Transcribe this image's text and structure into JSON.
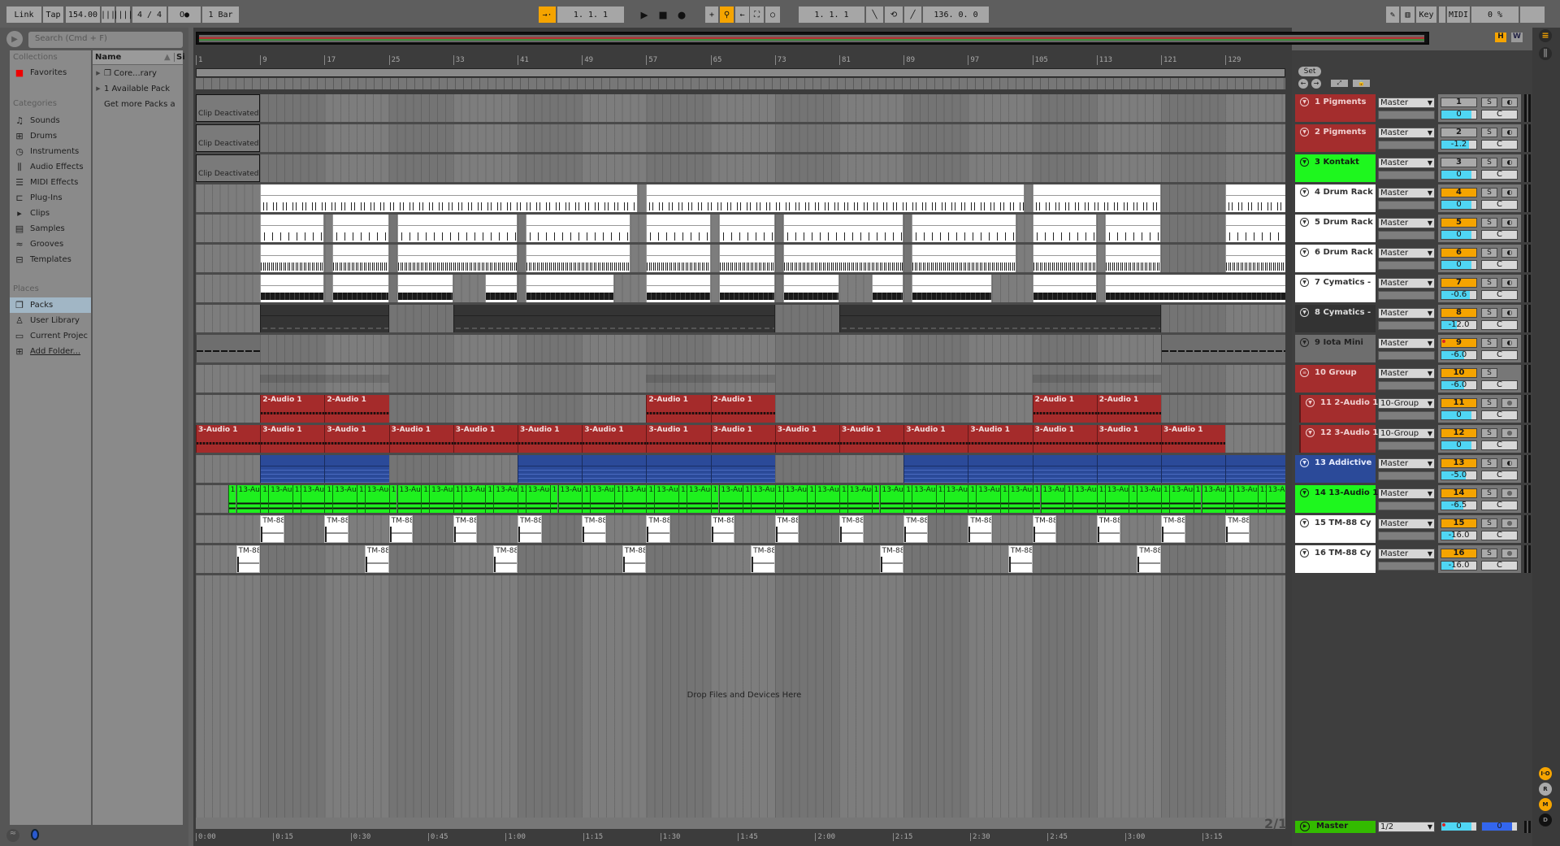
{
  "topbar": {
    "link": "Link",
    "tap": "Tap",
    "tempo": "154.00",
    "signature": "4 / 4",
    "metronome": "O●",
    "quantize": "1 Bar",
    "position": "1.  1.  1",
    "loop_start": "1.  1.  1",
    "loop_length": "136.  0.  0",
    "key": "Key",
    "midi": "MIDI",
    "cpu": "0 %"
  },
  "browser": {
    "search_placeholder": "Search (Cmd + F)",
    "collections_header": "Collections",
    "favorites": "Favorites",
    "categories_header": "Categories",
    "categories": [
      {
        "label": "Sounds",
        "icon": "♫"
      },
      {
        "label": "Drums",
        "icon": "⊞"
      },
      {
        "label": "Instruments",
        "icon": "◷"
      },
      {
        "label": "Audio Effects",
        "icon": "⫼"
      },
      {
        "label": "MIDI Effects",
        "icon": "☰"
      },
      {
        "label": "Plug-Ins",
        "icon": "⊏"
      },
      {
        "label": "Clips",
        "icon": "▸"
      },
      {
        "label": "Samples",
        "icon": "▤"
      },
      {
        "label": "Grooves",
        "icon": "≈"
      },
      {
        "label": "Templates",
        "icon": "⊟"
      }
    ],
    "places_header": "Places",
    "places": [
      {
        "label": "Packs",
        "icon": "❐",
        "selected": true
      },
      {
        "label": "User Library",
        "icon": "♙"
      },
      {
        "label": "Current Projec",
        "icon": "▭"
      },
      {
        "label": "Add Folder...",
        "icon": "⊞"
      }
    ],
    "name_header": "Name",
    "size_header": "Si",
    "items": [
      {
        "label": "Core...rary",
        "expand": "▶",
        "icon": "❐"
      },
      {
        "label": "1 Available Pack",
        "expand": "▶"
      },
      {
        "label": "Get more Packs a"
      }
    ]
  },
  "arrangement": {
    "overview_buttons": [
      "H",
      "W"
    ],
    "bar_labels": [
      "1",
      "9",
      "17",
      "25",
      "33",
      "41",
      "49",
      "57",
      "65",
      "73",
      "81",
      "89",
      "97",
      "105",
      "113",
      "121",
      "129"
    ],
    "time_labels": [
      "0:00",
      "0:15",
      "0:30",
      "0:45",
      "1:00",
      "1:15",
      "1:30",
      "1:45",
      "2:00",
      "2:15",
      "2:30",
      "2:45",
      "3:00",
      "3:15"
    ],
    "drop_text": "Drop Files and Devices Here",
    "time_sig_display": "2/1"
  },
  "set_label": "Set",
  "tracks": [
    {
      "name": "1 Pigments",
      "color": "#a42d2d",
      "text": "#f1d0d0",
      "output": "Master",
      "num": "1",
      "active": false,
      "vol": "0",
      "vol_frac": 0.85,
      "pan": "C",
      "arm": "◐",
      "kind": "deact",
      "clips": [
        [
          1,
          9,
          "Clip Deactivated"
        ]
      ]
    },
    {
      "name": "2 Pigments",
      "color": "#a42d2d",
      "text": "#f1d0d0",
      "output": "Master",
      "num": "2",
      "active": false,
      "vol": "-1.2",
      "vol_frac": 0.8,
      "pan": "C",
      "arm": "◐",
      "kind": "deact",
      "clips": [
        [
          1,
          9,
          "Clip Deactivated"
        ]
      ]
    },
    {
      "name": "3 Kontakt",
      "color": "#1ef71e",
      "text": "#102010",
      "output": "Master",
      "num": "3",
      "active": false,
      "vol": "0",
      "vol_frac": 0.85,
      "pan": "C",
      "arm": "◐",
      "kind": "deact",
      "clips": [
        [
          1,
          9,
          "Clip Deactivated"
        ]
      ]
    },
    {
      "name": "4 Drum Rack",
      "color": "#ffffff",
      "text": "#333",
      "output": "Master",
      "num": "4",
      "active": true,
      "vol": "0",
      "vol_frac": 0.85,
      "pan": "C",
      "arm": "◐",
      "kind": "midi",
      "clips": [
        [
          9,
          56,
          ""
        ],
        [
          57,
          104,
          ""
        ],
        [
          105,
          121,
          ""
        ],
        [
          129,
          137,
          ""
        ]
      ]
    },
    {
      "name": "5 Drum Rack",
      "color": "#ffffff",
      "text": "#333",
      "output": "Master",
      "num": "5",
      "active": true,
      "vol": "0",
      "vol_frac": 0.85,
      "pan": "C",
      "arm": "◐",
      "kind": "midi midi2",
      "clips": [
        [
          9,
          17,
          ""
        ],
        [
          18,
          25,
          ""
        ],
        [
          26,
          41,
          ""
        ],
        [
          42,
          55,
          ""
        ],
        [
          57,
          65,
          ""
        ],
        [
          66,
          73,
          ""
        ],
        [
          74,
          89,
          ""
        ],
        [
          90,
          103,
          ""
        ],
        [
          105,
          113,
          ""
        ],
        [
          114,
          121,
          ""
        ],
        [
          129,
          137,
          ""
        ]
      ]
    },
    {
      "name": "6 Drum Rack",
      "color": "#ffffff",
      "text": "#333",
      "output": "Master",
      "num": "6",
      "active": true,
      "vol": "0",
      "vol_frac": 0.85,
      "pan": "C",
      "arm": "◐",
      "kind": "midi midi3",
      "clips": [
        [
          9,
          17,
          ""
        ],
        [
          18,
          25,
          ""
        ],
        [
          26,
          41,
          ""
        ],
        [
          42,
          55,
          ""
        ],
        [
          57,
          65,
          ""
        ],
        [
          66,
          73,
          ""
        ],
        [
          74,
          89,
          ""
        ],
        [
          90,
          103,
          ""
        ],
        [
          105,
          113,
          ""
        ],
        [
          114,
          121,
          ""
        ],
        [
          129,
          137,
          ""
        ]
      ]
    },
    {
      "name": "7 Cymatics -",
      "color": "#ffffff",
      "text": "#333",
      "output": "Master",
      "num": "7",
      "active": true,
      "vol": "-0.6",
      "vol_frac": 0.82,
      "pan": "C",
      "arm": "◐",
      "kind": "midi midi4",
      "clips": [
        [
          9,
          17,
          ""
        ],
        [
          18,
          25,
          ""
        ],
        [
          26,
          33,
          ""
        ],
        [
          37,
          41,
          ""
        ],
        [
          42,
          53,
          ""
        ],
        [
          57,
          65,
          ""
        ],
        [
          66,
          73,
          ""
        ],
        [
          74,
          81,
          ""
        ],
        [
          85,
          89,
          ""
        ],
        [
          90,
          100,
          ""
        ],
        [
          105,
          113,
          ""
        ],
        [
          114,
          137,
          ""
        ]
      ]
    },
    {
      "name": "8 Cymatics -",
      "color": "#333333",
      "text": "#dddddd",
      "output": "Master",
      "num": "8",
      "active": true,
      "vol": "-12.0",
      "vol_frac": 0.45,
      "pan": "C",
      "arm": "◐",
      "kind": "dark",
      "clips": [
        [
          9,
          25,
          ""
        ],
        [
          33,
          73,
          ""
        ],
        [
          81,
          121,
          ""
        ]
      ]
    },
    {
      "name": "9 Iota Mini",
      "color": "#6e6e6e",
      "text": "#222",
      "output": "Master",
      "num": "9",
      "active": true,
      "rec_dot": true,
      "vol": "-6.0",
      "vol_frac": 0.65,
      "pan": "C",
      "arm": "◐",
      "kind": "grey",
      "clips": [
        [
          1,
          9,
          ""
        ],
        [
          121,
          137,
          ""
        ]
      ]
    },
    {
      "name": "10 Group",
      "color": "#a42d2d",
      "text": "#f1d0d0",
      "output": "Master",
      "num": "10",
      "active": true,
      "vol": "-6.0",
      "vol_frac": 0.65,
      "pan": "C",
      "arm": "",
      "group": true,
      "kind": "group",
      "clips": [
        [
          9,
          25,
          ""
        ],
        [
          57,
          73,
          ""
        ],
        [
          105,
          121,
          ""
        ]
      ]
    },
    {
      "name": "11 2-Audio 1",
      "color": "#a42d2d",
      "text": "#f1d0d0",
      "output": "10-Group",
      "num": "11",
      "active": true,
      "vol": "0",
      "vol_frac": 0.85,
      "pan": "C",
      "arm": "●",
      "indent": true,
      "kind": "red",
      "clips": [
        [
          9,
          17,
          "2-Audio 1"
        ],
        [
          17,
          25,
          "2-Audio 1"
        ],
        [
          57,
          65,
          "2-Audio 1"
        ],
        [
          65,
          73,
          "2-Audio 1"
        ],
        [
          105,
          113,
          "2-Audio 1"
        ],
        [
          113,
          121,
          "2-Audio 1"
        ]
      ]
    },
    {
      "name": "12 3-Audio 1",
      "color": "#a42d2d",
      "text": "#f1d0d0",
      "output": "10-Group",
      "num": "12",
      "active": true,
      "vol": "0",
      "vol_frac": 0.85,
      "pan": "C",
      "arm": "●",
      "indent": true,
      "kind": "red",
      "repeat": {
        "start": 1,
        "len": 8,
        "every": 8,
        "until": 121,
        "label": "3-Audio 1"
      }
    },
    {
      "name": "13 Addictive",
      "color": "#2b4a99",
      "text": "#e6ecff",
      "output": "Master",
      "num": "13",
      "active": true,
      "vol": "-5.0",
      "vol_frac": 0.7,
      "pan": "C",
      "arm": "◐",
      "kind": "blue",
      "clips": [
        [
          9,
          17,
          ""
        ],
        [
          17,
          25,
          ""
        ],
        [
          41,
          49,
          ""
        ],
        [
          49,
          57,
          ""
        ],
        [
          57,
          65,
          ""
        ],
        [
          65,
          73,
          ""
        ],
        [
          89,
          97,
          ""
        ],
        [
          97,
          105,
          ""
        ],
        [
          105,
          113,
          ""
        ],
        [
          113,
          121,
          ""
        ],
        [
          121,
          129,
          ""
        ],
        [
          129,
          137,
          ""
        ]
      ]
    },
    {
      "name": "14 13-Audio 1",
      "color": "#1ef71e",
      "text": "#102010",
      "output": "Master",
      "num": "14",
      "active": true,
      "vol": "-6.5",
      "vol_frac": 0.63,
      "pan": "C",
      "arm": "●",
      "kind": "green",
      "repeats": [
        {
          "start": 5,
          "len": 1,
          "every": 4,
          "until": 137,
          "label": "13-Audio 1"
        },
        {
          "start": 6,
          "len": 3,
          "every": 4,
          "until": 137,
          "label": "13-Audio 1"
        }
      ]
    },
    {
      "name": "15 TM-88 Cy",
      "color": "#ffffff",
      "text": "#333",
      "output": "Master",
      "num": "15",
      "active": true,
      "vol": "-16.0",
      "vol_frac": 0.35,
      "pan": "C",
      "arm": "●",
      "kind": "tm",
      "repeat": {
        "start": 9,
        "len": 3,
        "every": 8,
        "until": 130,
        "label": "TM-88 Cy"
      }
    },
    {
      "name": "16 TM-88 Cy",
      "color": "#ffffff",
      "text": "#333",
      "output": "Master",
      "num": "16",
      "active": true,
      "vol": "-16.0",
      "vol_frac": 0.35,
      "pan": "C",
      "arm": "●",
      "kind": "tm",
      "repeat": {
        "start": 6,
        "len": 3,
        "every": 16,
        "until": 119,
        "label": "TM-88 Cy"
      }
    }
  ],
  "master": {
    "name": "Master",
    "output": "1/2",
    "vol": "0",
    "vol_frac": 0.85,
    "cue": "0",
    "cue_frac": 0.85
  },
  "right_strip": [
    "I·O",
    "R",
    "M",
    "D"
  ]
}
